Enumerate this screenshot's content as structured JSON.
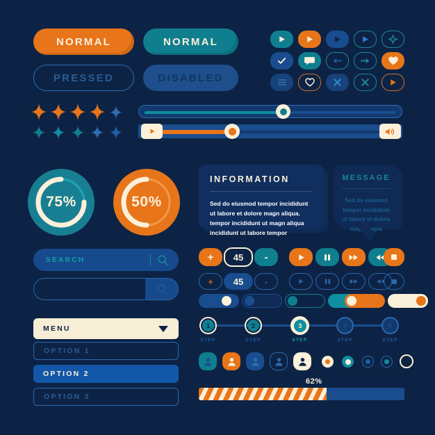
{
  "theme": {
    "background": "#0d2345",
    "orange": "#e8751a",
    "teal": "#0f7f8f",
    "teal_bright": "#13a0a8",
    "blue": "#1a4d8f",
    "blue_light": "#2a68ad",
    "blue_deep": "#123a6e",
    "cream": "#fbf0d9",
    "cream_panel": "#f7eed6",
    "navy_panel": "#102f5f",
    "navy_panel_dim": "#0f2a55",
    "disabled_text": "#10365f",
    "pressed_text": "#2a5c94"
  },
  "buttons": {
    "normal_orange": "NORMAL",
    "normal_teal": "NORMAL",
    "pressed": "PRESSED",
    "disabled": "DISABLED"
  },
  "icon_buttons": {
    "row1": [
      {
        "name": "play-icon",
        "style": "sq-teal",
        "glyph": "play",
        "color": "#fbf0d9"
      },
      {
        "name": "play-icon",
        "style": "sq-orange",
        "glyph": "play",
        "color": "#fbf0d9"
      },
      {
        "name": "play-icon",
        "style": "sq-blue",
        "glyph": "play",
        "color": "#0d2345"
      },
      {
        "name": "play-icon",
        "style": "out-teal",
        "glyph": "play",
        "color": "#2f7fd0"
      },
      {
        "name": "sparkle-icon",
        "style": "out-teal",
        "glyph": "sparkle",
        "color": "#1b8a9c"
      }
    ],
    "row2": [
      {
        "name": "check-icon",
        "style": "sq-blue",
        "glyph": "check",
        "color": "#fbf0d9"
      },
      {
        "name": "chat-bubble-icon",
        "style": "sq-teal",
        "glyph": "chat",
        "color": "#fbf0d9"
      },
      {
        "name": "arrow-left-icon",
        "style": "out-teal",
        "glyph": "arrow-left",
        "color": "#1f5fa8"
      },
      {
        "name": "arrow-right-icon",
        "style": "out-teal",
        "glyph": "arrow-right",
        "color": "#1b8a9c"
      },
      {
        "name": "heart-icon",
        "style": "sq-orange",
        "glyph": "heart",
        "color": "#fbf0d9"
      }
    ],
    "row3": [
      {
        "name": "menu-lines-icon",
        "style": "sq-bluedim",
        "glyph": "lines",
        "color": "#2f6cb0"
      },
      {
        "name": "heart-outline-icon",
        "style": "out-orange",
        "glyph": "heart-outline",
        "color": "#fbf0d9"
      },
      {
        "name": "close-icon",
        "style": "sq-bluedim",
        "glyph": "x",
        "color": "#2f8fcf"
      },
      {
        "name": "close-icon",
        "style": "out-teal",
        "glyph": "x",
        "color": "#1b8a9c"
      },
      {
        "name": "play-icon",
        "style": "out-orange",
        "glyph": "play",
        "color": "#e8751a"
      }
    ]
  },
  "stars": {
    "row1": [
      "#e8751a",
      "#e8751a",
      "#e8751a",
      "#e8751a",
      "#2f6cb0"
    ],
    "row2": [
      "#0f7f8f",
      "#0f8fa0",
      "#0f7f8f",
      "#2f6cb0",
      "#1f5fa8"
    ]
  },
  "sliders": [
    {
      "name": "slider-teal",
      "value_percent": 55,
      "fill_color": "#0f8fa0",
      "knob_color": "#fbf0d9",
      "knob_dot_color": "#0f7f8f"
    },
    {
      "name": "slider-orange-volume",
      "value_percent": 33,
      "fill_color": "#e8751a",
      "knob_color": "#fbf0d9",
      "knob_dot_color": "#e8751a",
      "left_cap_icon": "play-icon",
      "right_cap_icon": "volume-icon"
    }
  ],
  "rings": [
    {
      "name": "ring-progress-teal",
      "label": "75%",
      "value": 75,
      "ring_color": "#fbf0d9",
      "disc_color": "#187f93",
      "track_color": "#22a3b5"
    },
    {
      "name": "ring-progress-orange",
      "label": "50%",
      "value": 50,
      "ring_color": "#fbf0d9",
      "disc_color": "#e8751a",
      "track_color": "#f09a48"
    }
  ],
  "panels": {
    "information": {
      "title": "INFORMATION",
      "body": "Sed do eiusmod tempor incididunt ut labore et dolore magn aliqua. tempor incididunt ut magn aliqua incididunt ut labore tempor",
      "title_color": "#fbf0d9",
      "body_color": "#ffffff"
    },
    "message": {
      "title": "MESSAGE",
      "body": "Sed do eiusmod tempor incididunt ut labore et dolore magn aliqua",
      "title_color": "#18849a",
      "body_color": "#1b5f8e"
    }
  },
  "search": {
    "filled": {
      "name": "search-input-filled",
      "label": "SEARCH",
      "icon": "search-icon"
    },
    "outline": {
      "name": "search-input-empty",
      "placeholder": "",
      "icon": "search-icon"
    }
  },
  "menu": {
    "main_label": "MENU",
    "caret_icon": "chevron-down-icon",
    "options": [
      {
        "label": "OPTION 1",
        "state": "idle"
      },
      {
        "label": "OPTION 2",
        "state": "active"
      },
      {
        "label": "OPTION 3",
        "state": "idle"
      }
    ]
  },
  "stepper": {
    "active": {
      "plus": "+",
      "value": "45",
      "minus": "-"
    },
    "disabled": {
      "plus": "+",
      "value": "45",
      "minus": "-"
    }
  },
  "media_controls": {
    "active": [
      {
        "name": "play-button",
        "glyph": "play",
        "style": "sbtn-orange"
      },
      {
        "name": "pause-button",
        "glyph": "pause",
        "style": "sbtn-teal"
      },
      {
        "name": "fast-forward-button",
        "glyph": "ffwd",
        "style": "sbtn-orange"
      },
      {
        "name": "rewind-button",
        "glyph": "rwd",
        "style": "sbtn-teal"
      },
      {
        "name": "stop-button",
        "glyph": "stop",
        "style": "sbtn-orange"
      }
    ],
    "disabled": [
      {
        "name": "play-button-disabled",
        "glyph": "play"
      },
      {
        "name": "pause-button-disabled",
        "glyph": "pause"
      },
      {
        "name": "fast-forward-button-disabled",
        "glyph": "ffwd"
      },
      {
        "name": "rewind-button-disabled",
        "glyph": "rwd"
      },
      {
        "name": "stop-button-disabled",
        "glyph": "stop"
      }
    ]
  },
  "toggles": [
    {
      "name": "toggle-blue-on",
      "track": "#1a4d8f",
      "knob": "#fbf0d9",
      "on": true
    },
    {
      "name": "toggle-blue-off",
      "track": "#0f2a55",
      "knob": "#1a4d8f",
      "on": false,
      "border": "#1a4d8f"
    },
    {
      "name": "toggle-teal-off",
      "track": "#0d2345",
      "knob": "#0f7f8f",
      "on": false,
      "border": "#0f7f8f"
    },
    {
      "name": "toggle-teal-on",
      "track": "#0f8fa0",
      "knob": "#1a4d8f",
      "on": true
    },
    {
      "name": "toggle-orange-on-cream",
      "track": "#e8751a",
      "knob": "#fbf0d9",
      "on": false
    },
    {
      "name": "toggle-cream-orange",
      "track": "#fbf0d9",
      "knob": "#e8751a",
      "on": true
    }
  ],
  "steps": {
    "caption": "STEP",
    "items": [
      {
        "number": "1",
        "state": "done",
        "fill": "#0f7f8f",
        "text": "#0d2345",
        "halo": "#fbf0d9"
      },
      {
        "number": "2",
        "state": "done",
        "fill": "#0f7f8f",
        "text": "#0d2345",
        "halo": "#fbf0d9"
      },
      {
        "number": "3",
        "state": "current",
        "fill": "#0f8fa0",
        "text": "#fbf0d9",
        "halo": "#fbf0d9"
      },
      {
        "number": "4",
        "state": "upcoming",
        "fill": "#123a6e",
        "text": "#1a4d8f",
        "halo": "#2a68ad"
      },
      {
        "number": "5",
        "state": "upcoming",
        "fill": "#123a6e",
        "text": "#1a4d8f",
        "halo": "#2a68ad"
      }
    ],
    "caption_colors": [
      "#1f5fa8",
      "#1f5fa8",
      "#13a0a8",
      "#1f5fa8",
      "#1f5fa8"
    ]
  },
  "avatars": [
    {
      "name": "avatar-teal",
      "bg": "#0f7f8f",
      "fg": "#1a4d8f",
      "outline": false
    },
    {
      "name": "avatar-orange",
      "bg": "#e8751a",
      "fg": "#fbf0d9",
      "outline": false
    },
    {
      "name": "avatar-blue",
      "bg": "#1a4d8f",
      "fg": "#2a68ad",
      "outline": false
    },
    {
      "name": "avatar-outline",
      "bg": "transparent",
      "fg": "#2a68ad",
      "outline": true
    },
    {
      "name": "avatar-cream",
      "bg": "#fbf0d9",
      "fg": "#0d2345",
      "outline": false
    }
  ],
  "radios": [
    {
      "name": "radio-cream-orange",
      "ring": "#fbf0d9",
      "dot": "#e8751a",
      "style": "filled"
    },
    {
      "name": "radio-teal-cream",
      "ring": "#0f8fa0",
      "dot": "#fbf0d9",
      "style": "filled"
    },
    {
      "name": "radio-outline-blue",
      "ring": "#2a68ad",
      "dot": "#1a5fa8",
      "style": "outline"
    },
    {
      "name": "radio-outline-teal",
      "ring": "#2a68ad",
      "dot": "#0f8fa0",
      "style": "outline"
    },
    {
      "name": "radio-cream-outline",
      "ring": "#fbf0d9",
      "dot": "#0d2345",
      "style": "outline-thick"
    }
  ],
  "bottom_progress": {
    "name": "progress-bar-striped",
    "label": "62%",
    "value": 62,
    "track_color": "#1a4d8f",
    "stripe_a": "#e8751a",
    "stripe_b": "#fbf0d9"
  }
}
